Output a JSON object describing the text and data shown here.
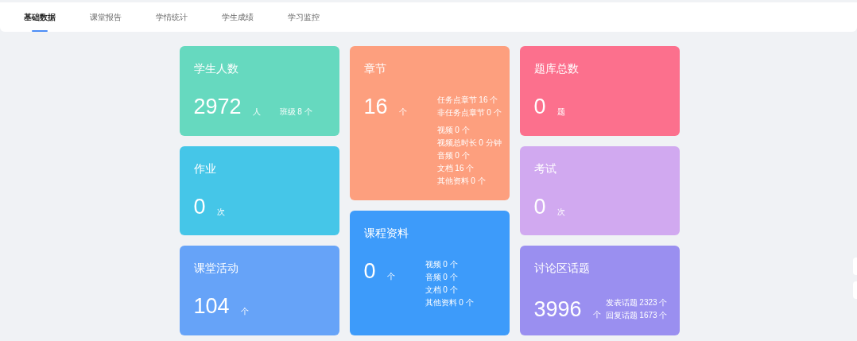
{
  "tabs": [
    {
      "label": "基础数据",
      "selected": true
    },
    {
      "label": "课堂报告",
      "selected": false
    },
    {
      "label": "学情统计",
      "selected": false
    },
    {
      "label": "学生成绩",
      "selected": false
    },
    {
      "label": "学习监控",
      "selected": false
    }
  ],
  "columns": [
    [
      {
        "title": "学生人数",
        "value": "2972",
        "unit": "人",
        "color": "#66d9bf",
        "note": "班级 8 个"
      },
      {
        "title": "作业",
        "value": "0",
        "unit": "次",
        "color": "#45c6e8"
      },
      {
        "title": "课堂活动",
        "value": "104",
        "unit": "个",
        "color": "#66a3f8"
      }
    ],
    [
      {
        "title": "章节",
        "value": "16",
        "unit": "个",
        "color": "#fd9f7e",
        "details": [
          [
            "任务点章节 16 个",
            "非任务点章节 0 个"
          ],
          [
            "视频 0 个",
            "视频总时长 0 分钟",
            "音频 0 个",
            "文档 16 个",
            "其他资料 0 个"
          ]
        ]
      },
      {
        "title": "课程资料",
        "value": "0",
        "unit": "个",
        "color": "#3d9bfa",
        "details": [
          [
            "视频 0 个",
            "音频 0 个",
            "文档 0 个",
            "其他资料 0 个"
          ]
        ]
      }
    ],
    [
      {
        "title": "题库总数",
        "value": "0",
        "unit": "题",
        "color": "#fc708d"
      },
      {
        "title": "考试",
        "value": "0",
        "unit": "次",
        "color": "#d1a9f0"
      },
      {
        "title": "讨论区话题",
        "value": "3996",
        "unit": "个",
        "color": "#9a8ff0",
        "details": [
          [
            "发表话题 2323 个",
            "回复话题 1673 个"
          ]
        ]
      }
    ]
  ]
}
